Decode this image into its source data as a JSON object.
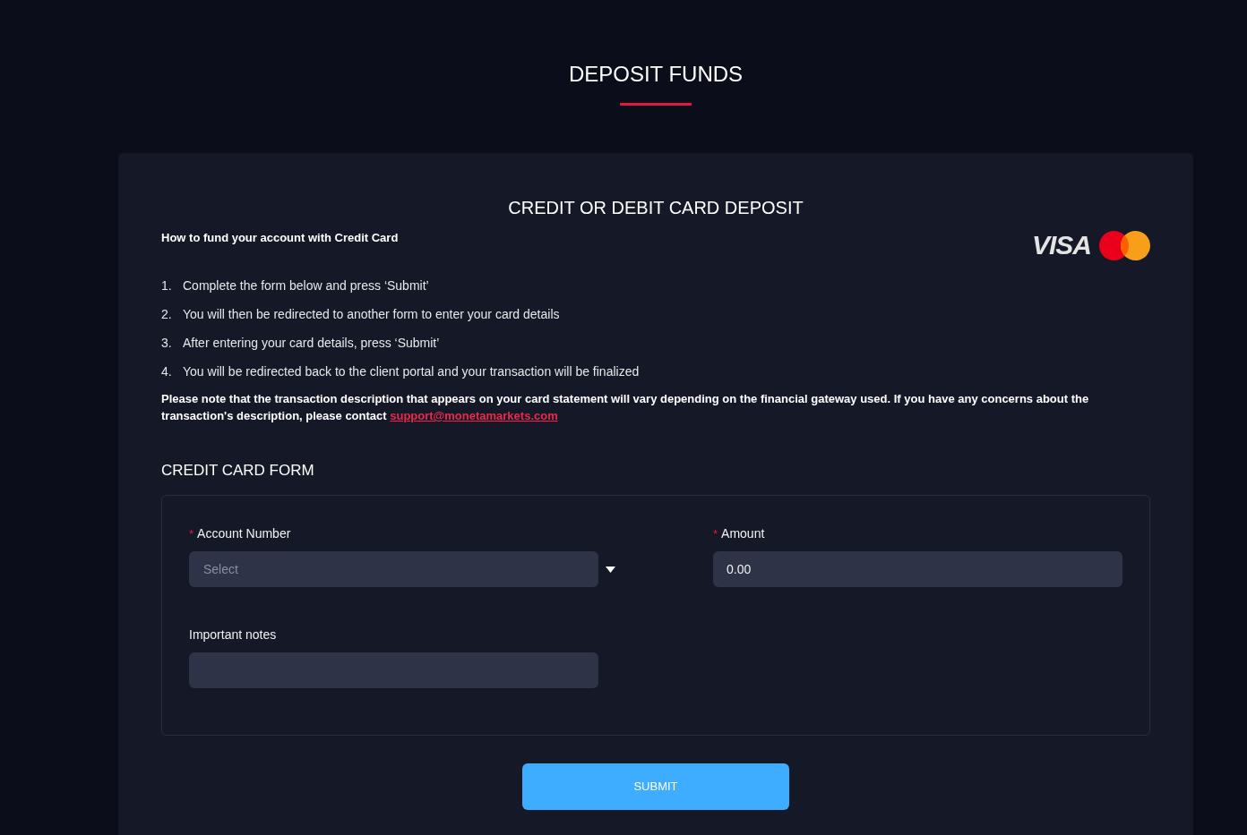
{
  "page": {
    "title": "DEPOSIT FUNDS"
  },
  "card": {
    "title": "CREDIT OR DEBIT CARD DEPOSIT",
    "subtitle": "How to fund your account with Credit Card",
    "visa_logo": "VISA"
  },
  "steps": [
    {
      "number": "1.",
      "text": "Complete the form below and press ‘Submit’"
    },
    {
      "number": "2.",
      "text": "You will then be redirected to another form to enter your card details"
    },
    {
      "number": "3.",
      "text": "After entering your card details, press ‘Submit’"
    },
    {
      "number": "4.",
      "text": "You will be redirected back to the client portal and your transaction will be finalized"
    }
  ],
  "note": {
    "text": "Please note that the transaction description that appears on your card statement will vary depending on the financial gateway used. If you have any concerns about the transaction's description, please contact",
    "link": "support@monetamarkets.com"
  },
  "form": {
    "title": "CREDIT CARD FORM",
    "fields": [
      {
        "kind": "select",
        "required_mark": "*",
        "label": "Account Number",
        "placeholder": "Select"
      },
      {
        "kind": "text",
        "required_mark": "*",
        "label": "Amount",
        "value": "0.00"
      },
      {
        "kind": "text",
        "label": "Important notes"
      }
    ]
  },
  "submit": {
    "label": "SUBMIT"
  }
}
